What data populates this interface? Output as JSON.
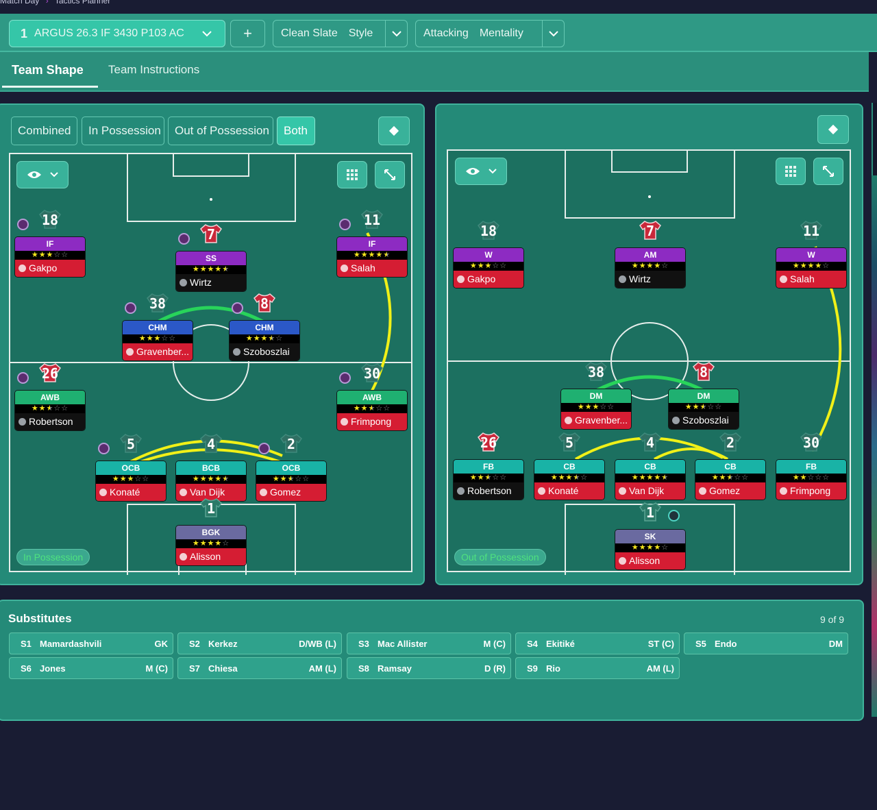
{
  "header": {
    "breadcrumb": [
      "Match Day",
      "Tactics Planner"
    ],
    "tactic_number": "1",
    "tactic_name": "ARGUS 26.3 IF 3430 P103 AC",
    "add_label": "+",
    "style_value": "Clean Slate",
    "style_label": "Style",
    "mentality_value": "Attacking",
    "mentality_label": "Mentality"
  },
  "tabs": [
    "Team Shape",
    "Team Instructions"
  ],
  "segments": [
    "Combined",
    "In Possession",
    "Out of Possession",
    "Both"
  ],
  "in_possession": {
    "label": "In Possession",
    "players": [
      {
        "num": "18",
        "role": "IF",
        "stars": 3.0,
        "name": "Gakpo",
        "role_color": "#8d2bc2",
        "name_bg": "red",
        "shirt": "grey",
        "ball": true
      },
      {
        "num": "7",
        "role": "SS",
        "stars": 4.5,
        "name": "Wirtz",
        "role_color": "#8d2bc2",
        "name_bg": "dark",
        "shirt": "red",
        "ball": true
      },
      {
        "num": "11",
        "role": "IF",
        "stars": 4.5,
        "name": "Salah",
        "role_color": "#8d2bc2",
        "name_bg": "red",
        "shirt": "grey",
        "ball": true
      },
      {
        "num": "38",
        "role": "CHM",
        "stars": 3.0,
        "name": "Gravenber...",
        "role_color": "#2b58c7",
        "name_bg": "red",
        "shirt": "grey",
        "ball": true
      },
      {
        "num": "8",
        "role": "CHM",
        "stars": 3.5,
        "name": "Szoboszlai",
        "role_color": "#2b58c7",
        "name_bg": "dark",
        "shirt": "red",
        "ball": true
      },
      {
        "num": "26",
        "role": "AWB",
        "stars": 2.5,
        "name": "Robertson",
        "role_color": "#1fb071",
        "name_bg": "dark",
        "shirt": "red",
        "ball": true
      },
      {
        "num": "30",
        "role": "AWB",
        "stars": 2.5,
        "name": "Frimpong",
        "role_color": "#1fb071",
        "name_bg": "red",
        "shirt": "grey",
        "ball": true
      },
      {
        "num": "5",
        "role": "OCB",
        "stars": 3.0,
        "name": "Konaté",
        "role_color": "#19b3a6",
        "name_bg": "red",
        "shirt": "grey",
        "ball": true
      },
      {
        "num": "4",
        "role": "BCB",
        "stars": 4.5,
        "name": "Van Dijk",
        "role_color": "#19b3a6",
        "name_bg": "red",
        "shirt": "grey",
        "ball": false
      },
      {
        "num": "2",
        "role": "OCB",
        "stars": 2.5,
        "name": "Gomez",
        "role_color": "#19b3a6",
        "name_bg": "red",
        "shirt": "grey",
        "ball": true
      },
      {
        "num": "1",
        "role": "BGK",
        "stars": 4.0,
        "name": "Alisson",
        "role_color": "#6a6aa0",
        "name_bg": "red",
        "shirt": "stripe",
        "ball": false
      }
    ]
  },
  "out_of_possession": {
    "label": "Out of Possession",
    "players": [
      {
        "num": "18",
        "role": "W",
        "stars": 3.0,
        "name": "Gakpo",
        "role_color": "#8d2bc2",
        "name_bg": "red",
        "shirt": "grey",
        "ball": false
      },
      {
        "num": "7",
        "role": "AM",
        "stars": 4.0,
        "name": "Wirtz",
        "role_color": "#8d2bc2",
        "name_bg": "dark",
        "shirt": "red",
        "ball": false
      },
      {
        "num": "11",
        "role": "W",
        "stars": 4.0,
        "name": "Salah",
        "role_color": "#8d2bc2",
        "name_bg": "red",
        "shirt": "grey",
        "ball": false
      },
      {
        "num": "38",
        "role": "DM",
        "stars": 3.0,
        "name": "Gravenber...",
        "role_color": "#1fb071",
        "name_bg": "red",
        "shirt": "grey",
        "ball": false
      },
      {
        "num": "8",
        "role": "DM",
        "stars": 2.5,
        "name": "Szoboszlai",
        "role_color": "#1fb071",
        "name_bg": "dark",
        "shirt": "red",
        "ball": false
      },
      {
        "num": "26",
        "role": "FB",
        "stars": 2.5,
        "name": "Robertson",
        "role_color": "#19b3a6",
        "name_bg": "dark",
        "shirt": "red",
        "ball": false
      },
      {
        "num": "5",
        "role": "CB",
        "stars": 3.5,
        "name": "Konaté",
        "role_color": "#19b3a6",
        "name_bg": "red",
        "shirt": "grey",
        "ball": false
      },
      {
        "num": "4",
        "role": "CB",
        "stars": 4.5,
        "name": "Van Dijk",
        "role_color": "#19b3a6",
        "name_bg": "red",
        "shirt": "grey",
        "ball": false
      },
      {
        "num": "2",
        "role": "CB",
        "stars": 2.5,
        "name": "Gomez",
        "role_color": "#19b3a6",
        "name_bg": "red",
        "shirt": "grey",
        "ball": false
      },
      {
        "num": "30",
        "role": "FB",
        "stars": 2.0,
        "name": "Frimpong",
        "role_color": "#19b3a6",
        "name_bg": "red",
        "shirt": "grey",
        "ball": false
      },
      {
        "num": "1",
        "role": "SK",
        "stars": 4.0,
        "name": "Alisson",
        "role_color": "#6a6aa0",
        "name_bg": "red",
        "shirt": "stripe",
        "ball": true
      }
    ]
  },
  "substitutes": {
    "title": "Substitutes",
    "count": "9 of 9",
    "items": [
      {
        "id": "S1",
        "name": "Mamardashvili",
        "pos": "GK"
      },
      {
        "id": "S2",
        "name": "Kerkez",
        "pos": "D/WB (L)"
      },
      {
        "id": "S3",
        "name": "Mac Allister",
        "pos": "M (C)"
      },
      {
        "id": "S4",
        "name": "Ekitiké",
        "pos": "ST (C)"
      },
      {
        "id": "S5",
        "name": "Endo",
        "pos": "DM"
      },
      {
        "id": "S6",
        "name": "Jones",
        "pos": "M (C)"
      },
      {
        "id": "S7",
        "name": "Chiesa",
        "pos": "AM (L)"
      },
      {
        "id": "S8",
        "name": "Ramsay",
        "pos": "D (R)"
      },
      {
        "id": "S9",
        "name": "Rio",
        "pos": "AM (L)"
      }
    ]
  },
  "icons": {
    "dropdown": "chevron-down-icon",
    "visibility": "eye-icon",
    "grid": "grid-icon",
    "expand": "expand-icon",
    "swap": "diamond-icon",
    "player": "person-icon"
  },
  "colors": {
    "accent": "#35c6a8",
    "panel": "#248a78",
    "pitch": "#1c7060",
    "star": "#f6e61e",
    "link_yellow": "#f0f018",
    "link_green": "#28d45a",
    "club_red": "#d51d33"
  }
}
